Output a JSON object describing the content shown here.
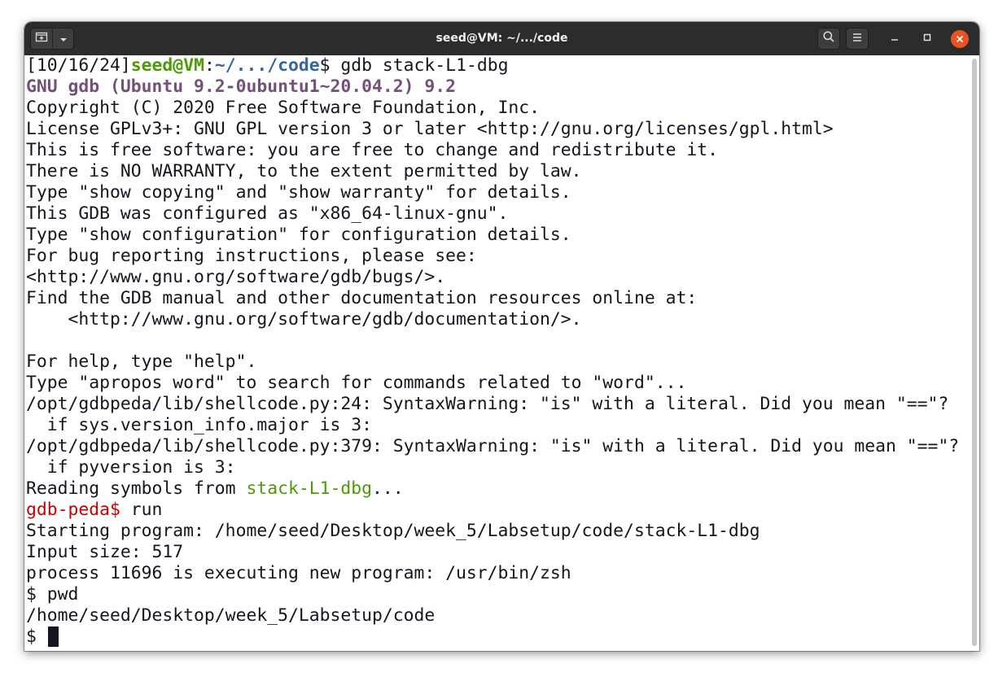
{
  "window": {
    "title": "seed@VM: ~/.../code"
  },
  "icons": {
    "new_tab": "new-tab-icon",
    "menu_dropdown": "chevron-down-icon",
    "search": "search-icon",
    "hamburger": "hamburger-menu-icon",
    "minimize": "minimize-icon",
    "maximize": "maximize-icon",
    "close": "close-icon"
  },
  "colors": {
    "titlebar": "#2c2c2c",
    "close_button": "#e95420",
    "prompt_user": "#4e9a06",
    "prompt_path": "#3465a4",
    "gdb_banner": "#75507b",
    "peda_prompt": "#cc0000",
    "text": "#171421"
  },
  "terminal": {
    "shell_prompt": {
      "time": "[10/16/24]",
      "user_host": "seed@VM",
      "colon": ":",
      "path": "~/.../code",
      "dollar": "$ ",
      "command": "gdb stack-L1-dbg"
    },
    "gdb_banner": "GNU gdb (Ubuntu 9.2-0ubuntu1~20.04.2) 9.2",
    "lines_a": [
      "Copyright (C) 2020 Free Software Foundation, Inc.",
      "License GPLv3+: GNU GPL version 3 or later <http://gnu.org/licenses/gpl.html>",
      "This is free software: you are free to change and redistribute it.",
      "There is NO WARRANTY, to the extent permitted by law.",
      "Type \"show copying\" and \"show warranty\" for details.",
      "This GDB was configured as \"x86_64-linux-gnu\".",
      "Type \"show configuration\" for configuration details.",
      "For bug reporting instructions, please see:",
      "<http://www.gnu.org/software/gdb/bugs/>.",
      "Find the GDB manual and other documentation resources online at:",
      "    <http://www.gnu.org/software/gdb/documentation/>.",
      "",
      "For help, type \"help\".",
      "Type \"apropos word\" to search for commands related to \"word\"...",
      "/opt/gdbpeda/lib/shellcode.py:24: SyntaxWarning: \"is\" with a literal. Did you mean \"==\"?",
      "  if sys.version_info.major is 3:",
      "/opt/gdbpeda/lib/shellcode.py:379: SyntaxWarning: \"is\" with a literal. Did you mean \"==\"?",
      "  if pyversion is 3:"
    ],
    "reading_prefix": "Reading symbols from ",
    "reading_file": "stack-L1-dbg",
    "reading_suffix": "...",
    "peda_prompt": "gdb-peda$",
    "peda_command": " run",
    "lines_b": [
      "Starting program: /home/seed/Desktop/week_5/Labsetup/code/stack-L1-dbg",
      "Input size: 517",
      "process 11696 is executing new program: /usr/bin/zsh",
      "$ pwd",
      "/home/seed/Desktop/week_5/Labsetup/code"
    ],
    "final_prompt": "$ "
  }
}
